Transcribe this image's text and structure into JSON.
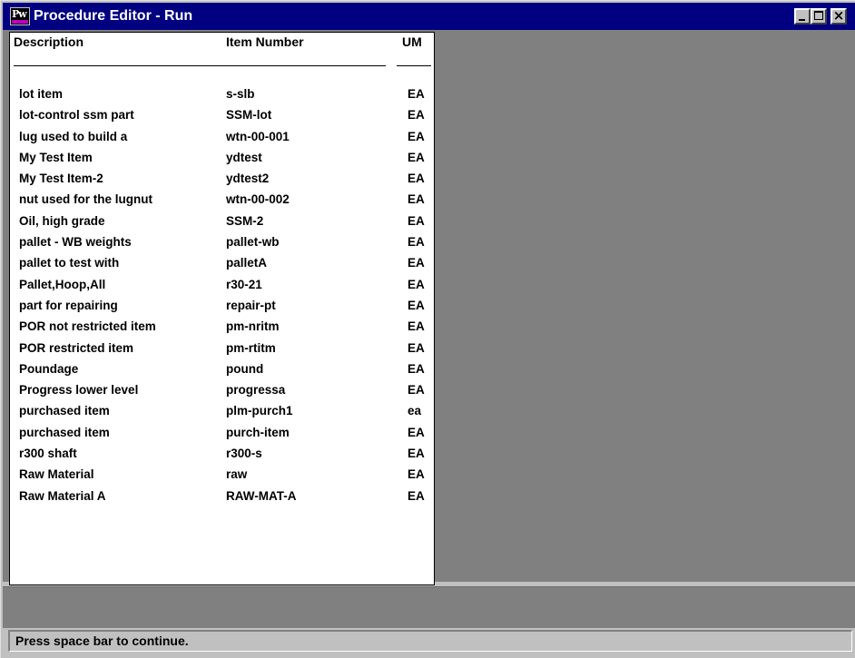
{
  "window": {
    "title": "Procedure Editor - Run",
    "icon": "progress-app-icon",
    "icon_text": "Pw",
    "controls": {
      "minimize": "minimize-icon",
      "maximize": "maximize-icon",
      "close": "close-icon"
    }
  },
  "table": {
    "columns": [
      "Description",
      "Item Number",
      "UM"
    ],
    "rows": [
      [
        "lot item",
        "s-slb",
        "EA"
      ],
      [
        "lot-control ssm part",
        "SSM-lot",
        "EA"
      ],
      [
        "lug used to build a",
        "wtn-00-001",
        "EA"
      ],
      [
        "My Test Item",
        "ydtest",
        "EA"
      ],
      [
        "My Test Item-2",
        "ydtest2",
        "EA"
      ],
      [
        "nut used for the lugnut",
        "wtn-00-002",
        "EA"
      ],
      [
        "Oil, high grade",
        "SSM-2",
        "EA"
      ],
      [
        "pallet - WB weights",
        "pallet-wb",
        "EA"
      ],
      [
        "pallet to test with",
        "palletA",
        "EA"
      ],
      [
        "Pallet,Hoop,All",
        "r30-21",
        "EA"
      ],
      [
        "part for repairing",
        "repair-pt",
        "EA"
      ],
      [
        "POR not restricted item",
        "pm-nritm",
        "EA"
      ],
      [
        "POR restricted item",
        "pm-rtitm",
        "EA"
      ],
      [
        "Poundage",
        "pound",
        "EA"
      ],
      [
        "Progress lower level",
        "progressa",
        "EA"
      ],
      [
        "purchased item",
        "plm-purch1",
        "ea"
      ],
      [
        "purchased item",
        "purch-item",
        "EA"
      ],
      [
        "r300 shaft",
        "r300-s",
        "EA"
      ],
      [
        "Raw Material",
        "raw",
        "EA"
      ],
      [
        "Raw Material A",
        "RAW-MAT-A",
        "EA"
      ]
    ]
  },
  "status": {
    "message": "Press space bar to continue."
  },
  "colors": {
    "titlebar": "#000080",
    "background": "#808080",
    "chrome": "#c0c0c0",
    "panel": "#ffffff"
  }
}
